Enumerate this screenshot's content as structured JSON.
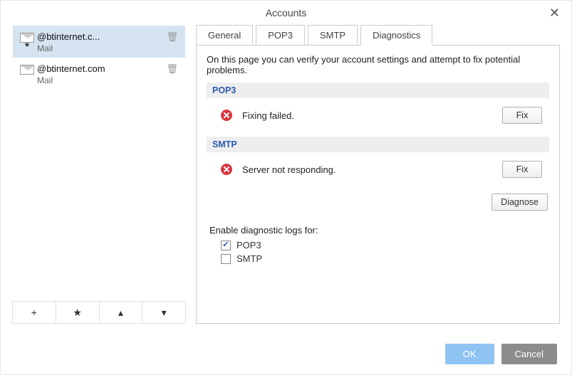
{
  "window": {
    "title": "Accounts",
    "close": "✕"
  },
  "sidebar": {
    "accounts": [
      {
        "email": "@btinternet.c...",
        "type": "Mail",
        "default": true
      },
      {
        "email": "@btinternet.com",
        "type": "Mail",
        "default": false
      }
    ],
    "toolbar": {
      "add": "+",
      "default": "★",
      "up": "▴",
      "down": "▾"
    }
  },
  "tabs": [
    {
      "id": "general",
      "label": "General"
    },
    {
      "id": "pop3",
      "label": "POP3"
    },
    {
      "id": "smtp",
      "label": "SMTP"
    },
    {
      "id": "diagnostics",
      "label": "Diagnostics",
      "active": true
    }
  ],
  "diagnostics": {
    "intro": "On this page you can verify your account settings and attempt to fix potential problems.",
    "sections": {
      "pop3": {
        "title": "POP3",
        "status": "Fixing failed.",
        "fix": "Fix"
      },
      "smtp": {
        "title": "SMTP",
        "status": "Server not responding.",
        "fix": "Fix"
      }
    },
    "diagnose": "Diagnose",
    "logs_label": "Enable diagnostic logs for:",
    "logs": {
      "pop3": {
        "label": "POP3",
        "checked": true
      },
      "smtp": {
        "label": "SMTP",
        "checked": false
      }
    }
  },
  "footer": {
    "ok": "OK",
    "cancel": "Cancel"
  }
}
